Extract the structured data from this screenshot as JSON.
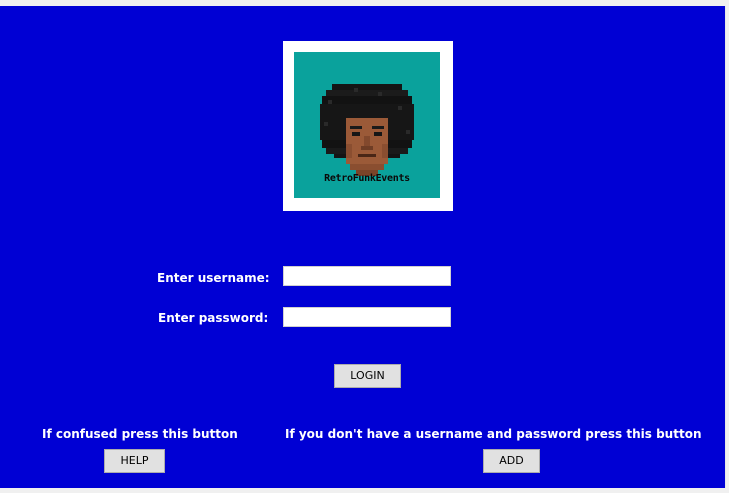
{
  "logo": {
    "text": "RetroFunkEvents",
    "icon": "afro-avatar-pixel-art"
  },
  "login_form": {
    "username_label": "Enter username:",
    "username_value": "",
    "password_label": "Enter password:",
    "password_value": "",
    "login_button": "LOGIN"
  },
  "help_section": {
    "text": "If confused press this button",
    "button": "HELP"
  },
  "add_section": {
    "text": "If you don't have a username and password press this button",
    "button": "ADD"
  },
  "colors": {
    "background": "#0000d4",
    "logo_background": "#0aa29c"
  }
}
